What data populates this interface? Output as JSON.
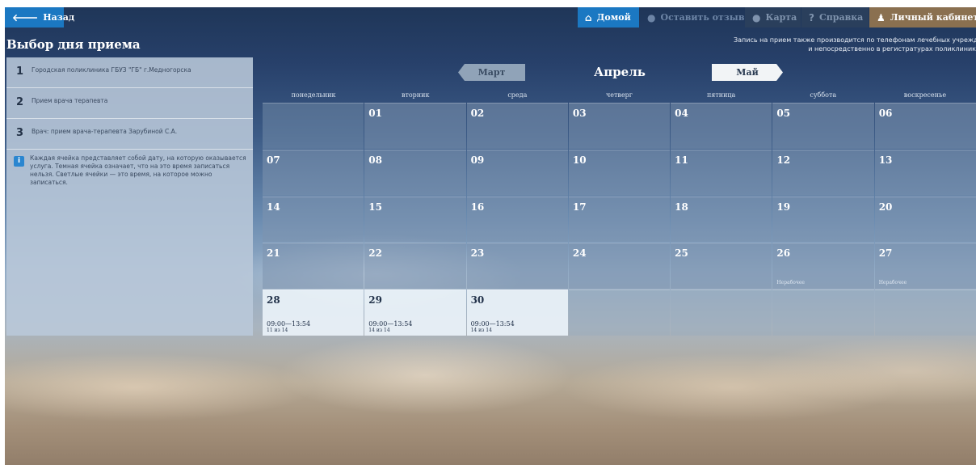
{
  "topbar": {
    "back_label": "Назад",
    "home_label": "Домой",
    "review_label": "Оставить отзыв",
    "map_label": "Карта",
    "help_label": "Справка",
    "cabinet_label": "Личный кабинет"
  },
  "page_title": "Выбор дня приема",
  "phone_note": {
    "line1": "Запись на прием также производится по телефонам лечебных учреждений",
    "line2": "и непосредственно в регистратурах поликлиник"
  },
  "steps": [
    {
      "num": "1",
      "text": "Городская поликлиника ГБУЗ \"ГБ\" г.Медногорска"
    },
    {
      "num": "2",
      "text": "Прием врача терапевта"
    },
    {
      "num": "3",
      "text": "Врач: прием врача-терапевта Зарубиной С.А."
    }
  ],
  "info": {
    "icon": "info-icon",
    "text": "Каждая ячейка представляет собой дату, на которую оказывается услуга. Темная ячейка означает, что на это время записаться нельзя. Светлые ячейки — это время, на которое можно записаться."
  },
  "calendar": {
    "prev_month": "Март",
    "current_month": "Апрель",
    "next_month": "Май",
    "weekdays": [
      "понедельник",
      "вторник",
      "среда",
      "четверг",
      "пятница",
      "суббота",
      "воскресенье"
    ],
    "days": [
      {
        "day": "",
        "state": "blank",
        "time": "",
        "slots": "",
        "note": ""
      },
      {
        "day": "01",
        "state": "dark",
        "time": "",
        "slots": "",
        "note": ""
      },
      {
        "day": "02",
        "state": "dark",
        "time": "",
        "slots": "",
        "note": ""
      },
      {
        "day": "03",
        "state": "dark",
        "time": "",
        "slots": "",
        "note": ""
      },
      {
        "day": "04",
        "state": "dark",
        "time": "",
        "slots": "",
        "note": ""
      },
      {
        "day": "05",
        "state": "dark",
        "time": "",
        "slots": "",
        "note": ""
      },
      {
        "day": "06",
        "state": "dark",
        "time": "",
        "slots": "",
        "note": ""
      },
      {
        "day": "07",
        "state": "dark",
        "time": "",
        "slots": "",
        "note": ""
      },
      {
        "day": "08",
        "state": "dark",
        "time": "",
        "slots": "",
        "note": ""
      },
      {
        "day": "09",
        "state": "dark",
        "time": "",
        "slots": "",
        "note": ""
      },
      {
        "day": "10",
        "state": "dark",
        "time": "",
        "slots": "",
        "note": ""
      },
      {
        "day": "11",
        "state": "dark",
        "time": "",
        "slots": "",
        "note": ""
      },
      {
        "day": "12",
        "state": "dark",
        "time": "",
        "slots": "",
        "note": ""
      },
      {
        "day": "13",
        "state": "dark",
        "time": "",
        "slots": "",
        "note": ""
      },
      {
        "day": "14",
        "state": "dark",
        "time": "",
        "slots": "",
        "note": ""
      },
      {
        "day": "15",
        "state": "dark",
        "time": "",
        "slots": "",
        "note": ""
      },
      {
        "day": "16",
        "state": "dark",
        "time": "",
        "slots": "",
        "note": ""
      },
      {
        "day": "17",
        "state": "dark",
        "time": "",
        "slots": "",
        "note": ""
      },
      {
        "day": "18",
        "state": "dark",
        "time": "",
        "slots": "",
        "note": ""
      },
      {
        "day": "19",
        "state": "dark",
        "time": "",
        "slots": "",
        "note": ""
      },
      {
        "day": "20",
        "state": "dark",
        "time": "",
        "slots": "",
        "note": ""
      },
      {
        "day": "21",
        "state": "dark",
        "time": "",
        "slots": "",
        "note": ""
      },
      {
        "day": "22",
        "state": "dark",
        "time": "",
        "slots": "",
        "note": ""
      },
      {
        "day": "23",
        "state": "dark",
        "time": "",
        "slots": "",
        "note": ""
      },
      {
        "day": "24",
        "state": "dark",
        "time": "",
        "slots": "",
        "note": ""
      },
      {
        "day": "25",
        "state": "dark",
        "time": "",
        "slots": "",
        "note": ""
      },
      {
        "day": "26",
        "state": "dark",
        "time": "",
        "slots": "",
        "note": "Нерабочее"
      },
      {
        "day": "27",
        "state": "dark",
        "time": "",
        "slots": "",
        "note": "Нерабочее"
      },
      {
        "day": "28",
        "state": "light",
        "time": "09:00—13:54",
        "slots": "11 из 14",
        "note": ""
      },
      {
        "day": "29",
        "state": "light",
        "time": "09:00—13:54",
        "slots": "14 из 14",
        "note": ""
      },
      {
        "day": "30",
        "state": "light",
        "time": "09:00—13:54",
        "slots": "14 из 14",
        "note": ""
      },
      {
        "day": "",
        "state": "empty",
        "time": "",
        "slots": "",
        "note": ""
      },
      {
        "day": "",
        "state": "empty",
        "time": "",
        "slots": "",
        "note": ""
      },
      {
        "day": "",
        "state": "empty",
        "time": "",
        "slots": "",
        "note": ""
      },
      {
        "day": "",
        "state": "empty",
        "time": "",
        "slots": "",
        "note": ""
      }
    ]
  },
  "colors": {
    "accent_blue": "#1b78c2",
    "cabinet_brown": "#8a7050",
    "light_cell": "#e8f0f7"
  }
}
